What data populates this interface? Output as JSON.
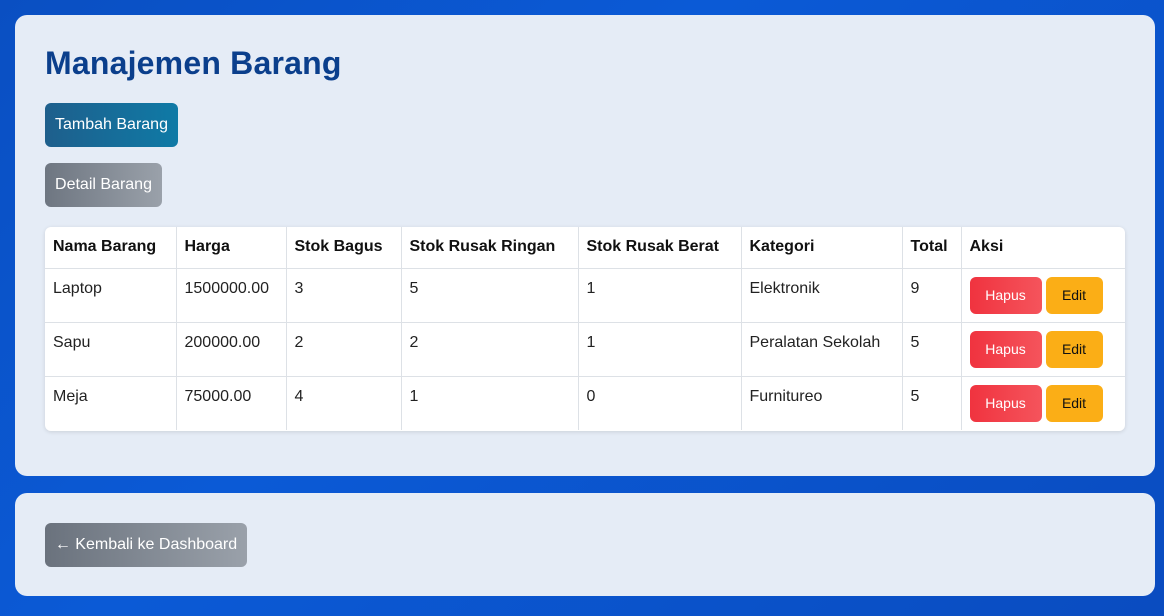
{
  "page": {
    "title": "Manajemen Barang",
    "add_button": "Tambah Barang",
    "detail_button": "Detail Barang",
    "back_button": "← Kembali ke Dashboard"
  },
  "table": {
    "headers": [
      "Nama Barang",
      "Harga",
      "Stok Bagus",
      "Stok Rusak Ringan",
      "Stok Rusak Berat",
      "Kategori",
      "Total",
      "Aksi"
    ],
    "rows": [
      {
        "nama": "Laptop",
        "harga": "1500000.00",
        "stok_bagus": "3",
        "stok_rusak_ringan": "5",
        "stok_rusak_berat": "1",
        "kategori": "Elektronik",
        "total": "9",
        "hapus": "Hapus",
        "edit": "Edit"
      },
      {
        "nama": "Sapu",
        "harga": "200000.00",
        "stok_bagus": "2",
        "stok_rusak_ringan": "2",
        "stok_rusak_berat": "1",
        "kategori": "Peralatan Sekolah",
        "total": "5",
        "hapus": "Hapus",
        "edit": "Edit"
      },
      {
        "nama": "Meja",
        "harga": "75000.00",
        "stok_bagus": "4",
        "stok_rusak_ringan": "1",
        "stok_rusak_berat": "0",
        "kategori": "Furnitureo",
        "total": "5",
        "hapus": "Hapus",
        "edit": "Edit"
      }
    ]
  },
  "colors": {
    "background": "#0b56d0",
    "card": "#e5ecf6",
    "title": "#0b3f8c",
    "hapus": "#f0333f",
    "edit": "#fbae16"
  }
}
